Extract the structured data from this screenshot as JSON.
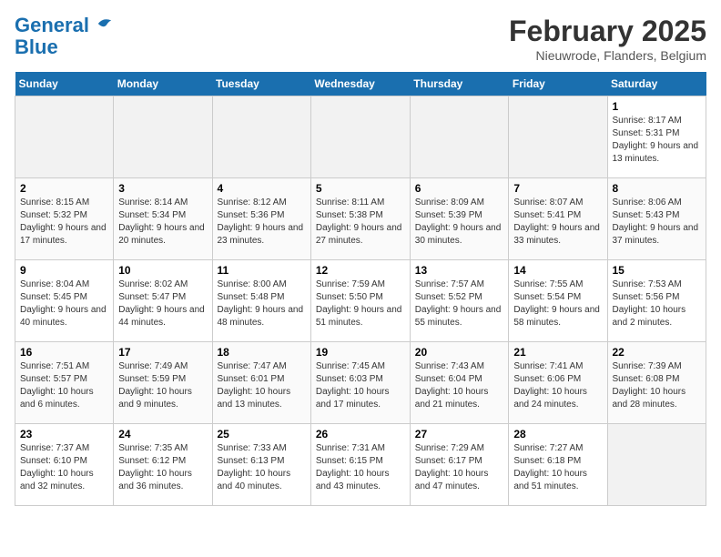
{
  "header": {
    "logo_line1": "General",
    "logo_line2": "Blue",
    "title": "February 2025",
    "subtitle": "Nieuwrode, Flanders, Belgium"
  },
  "days_of_week": [
    "Sunday",
    "Monday",
    "Tuesday",
    "Wednesday",
    "Thursday",
    "Friday",
    "Saturday"
  ],
  "weeks": [
    [
      {
        "day": "",
        "info": ""
      },
      {
        "day": "",
        "info": ""
      },
      {
        "day": "",
        "info": ""
      },
      {
        "day": "",
        "info": ""
      },
      {
        "day": "",
        "info": ""
      },
      {
        "day": "",
        "info": ""
      },
      {
        "day": "1",
        "info": "Sunrise: 8:17 AM\nSunset: 5:31 PM\nDaylight: 9 hours and 13 minutes."
      }
    ],
    [
      {
        "day": "2",
        "info": "Sunrise: 8:15 AM\nSunset: 5:32 PM\nDaylight: 9 hours and 17 minutes."
      },
      {
        "day": "3",
        "info": "Sunrise: 8:14 AM\nSunset: 5:34 PM\nDaylight: 9 hours and 20 minutes."
      },
      {
        "day": "4",
        "info": "Sunrise: 8:12 AM\nSunset: 5:36 PM\nDaylight: 9 hours and 23 minutes."
      },
      {
        "day": "5",
        "info": "Sunrise: 8:11 AM\nSunset: 5:38 PM\nDaylight: 9 hours and 27 minutes."
      },
      {
        "day": "6",
        "info": "Sunrise: 8:09 AM\nSunset: 5:39 PM\nDaylight: 9 hours and 30 minutes."
      },
      {
        "day": "7",
        "info": "Sunrise: 8:07 AM\nSunset: 5:41 PM\nDaylight: 9 hours and 33 minutes."
      },
      {
        "day": "8",
        "info": "Sunrise: 8:06 AM\nSunset: 5:43 PM\nDaylight: 9 hours and 37 minutes."
      }
    ],
    [
      {
        "day": "9",
        "info": "Sunrise: 8:04 AM\nSunset: 5:45 PM\nDaylight: 9 hours and 40 minutes."
      },
      {
        "day": "10",
        "info": "Sunrise: 8:02 AM\nSunset: 5:47 PM\nDaylight: 9 hours and 44 minutes."
      },
      {
        "day": "11",
        "info": "Sunrise: 8:00 AM\nSunset: 5:48 PM\nDaylight: 9 hours and 48 minutes."
      },
      {
        "day": "12",
        "info": "Sunrise: 7:59 AM\nSunset: 5:50 PM\nDaylight: 9 hours and 51 minutes."
      },
      {
        "day": "13",
        "info": "Sunrise: 7:57 AM\nSunset: 5:52 PM\nDaylight: 9 hours and 55 minutes."
      },
      {
        "day": "14",
        "info": "Sunrise: 7:55 AM\nSunset: 5:54 PM\nDaylight: 9 hours and 58 minutes."
      },
      {
        "day": "15",
        "info": "Sunrise: 7:53 AM\nSunset: 5:56 PM\nDaylight: 10 hours and 2 minutes."
      }
    ],
    [
      {
        "day": "16",
        "info": "Sunrise: 7:51 AM\nSunset: 5:57 PM\nDaylight: 10 hours and 6 minutes."
      },
      {
        "day": "17",
        "info": "Sunrise: 7:49 AM\nSunset: 5:59 PM\nDaylight: 10 hours and 9 minutes."
      },
      {
        "day": "18",
        "info": "Sunrise: 7:47 AM\nSunset: 6:01 PM\nDaylight: 10 hours and 13 minutes."
      },
      {
        "day": "19",
        "info": "Sunrise: 7:45 AM\nSunset: 6:03 PM\nDaylight: 10 hours and 17 minutes."
      },
      {
        "day": "20",
        "info": "Sunrise: 7:43 AM\nSunset: 6:04 PM\nDaylight: 10 hours and 21 minutes."
      },
      {
        "day": "21",
        "info": "Sunrise: 7:41 AM\nSunset: 6:06 PM\nDaylight: 10 hours and 24 minutes."
      },
      {
        "day": "22",
        "info": "Sunrise: 7:39 AM\nSunset: 6:08 PM\nDaylight: 10 hours and 28 minutes."
      }
    ],
    [
      {
        "day": "23",
        "info": "Sunrise: 7:37 AM\nSunset: 6:10 PM\nDaylight: 10 hours and 32 minutes."
      },
      {
        "day": "24",
        "info": "Sunrise: 7:35 AM\nSunset: 6:12 PM\nDaylight: 10 hours and 36 minutes."
      },
      {
        "day": "25",
        "info": "Sunrise: 7:33 AM\nSunset: 6:13 PM\nDaylight: 10 hours and 40 minutes."
      },
      {
        "day": "26",
        "info": "Sunrise: 7:31 AM\nSunset: 6:15 PM\nDaylight: 10 hours and 43 minutes."
      },
      {
        "day": "27",
        "info": "Sunrise: 7:29 AM\nSunset: 6:17 PM\nDaylight: 10 hours and 47 minutes."
      },
      {
        "day": "28",
        "info": "Sunrise: 7:27 AM\nSunset: 6:18 PM\nDaylight: 10 hours and 51 minutes."
      },
      {
        "day": "",
        "info": ""
      }
    ]
  ]
}
